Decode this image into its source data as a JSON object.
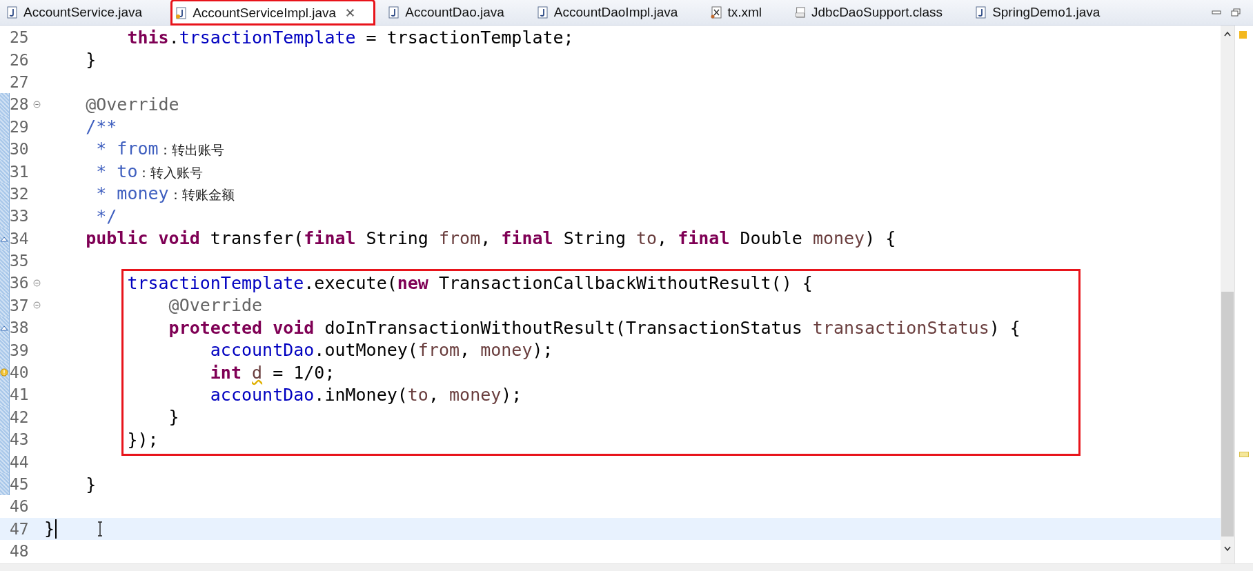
{
  "tabs": [
    {
      "label": "AccountService.java",
      "kind": "java",
      "selected": false,
      "boxed": false
    },
    {
      "label": "AccountServiceImpl.java",
      "kind": "java_warn",
      "selected": true,
      "boxed": true
    },
    {
      "label": "AccountDao.java",
      "kind": "java",
      "selected": false,
      "boxed": false
    },
    {
      "label": "AccountDaoImpl.java",
      "kind": "java",
      "selected": false,
      "boxed": false
    },
    {
      "label": "tx.xml",
      "kind": "xml",
      "selected": false,
      "boxed": false
    },
    {
      "label": "JdbcDaoSupport.class",
      "kind": "class",
      "selected": false,
      "boxed": false
    },
    {
      "label": "SpringDemo1.java",
      "kind": "java",
      "selected": false,
      "boxed": false
    }
  ],
  "lines": [
    {
      "num": "25",
      "tokens": [
        {
          "kind": "kw",
          "text": "        this"
        },
        {
          "kind": "plain",
          "text": "."
        },
        {
          "kind": "field",
          "text": "trsactionTemplate"
        },
        {
          "kind": "plain",
          "text": " = trsactionTemplate;"
        }
      ]
    },
    {
      "num": "26",
      "tokens": [
        {
          "kind": "plain",
          "text": "    }"
        }
      ]
    },
    {
      "num": "27"
    },
    {
      "num": "28",
      "fold": true,
      "scope": true,
      "tokens": [
        {
          "kind": "ann",
          "text": "    @Override"
        }
      ]
    },
    {
      "num": "29",
      "scope": true,
      "tokens": [
        {
          "kind": "doc",
          "text": "    /**"
        }
      ]
    },
    {
      "num": "30",
      "scope": true,
      "tokens": [
        {
          "kind": "doc",
          "text": "     * from"
        },
        {
          "kind": "cjk",
          "text": "：转出账号"
        }
      ]
    },
    {
      "num": "31",
      "scope": true,
      "tokens": [
        {
          "kind": "doc",
          "text": "     * to"
        },
        {
          "kind": "cjk",
          "text": "：转入账号"
        }
      ]
    },
    {
      "num": "32",
      "scope": true,
      "tokens": [
        {
          "kind": "doc",
          "text": "     * money"
        },
        {
          "kind": "cjk",
          "text": "：转账金额"
        }
      ]
    },
    {
      "num": "33",
      "scope": true,
      "tokens": [
        {
          "kind": "doc",
          "text": "     */"
        }
      ]
    },
    {
      "num": "34",
      "scope": true,
      "override": true,
      "tokens": [
        {
          "kind": "kw",
          "text": "    public void"
        },
        {
          "kind": "plain",
          "text": " transfer("
        },
        {
          "kind": "kw",
          "text": "final"
        },
        {
          "kind": "plain",
          "text": " String "
        },
        {
          "kind": "param",
          "text": "from"
        },
        {
          "kind": "plain",
          "text": ", "
        },
        {
          "kind": "kw",
          "text": "final"
        },
        {
          "kind": "plain",
          "text": " String "
        },
        {
          "kind": "param",
          "text": "to"
        },
        {
          "kind": "plain",
          "text": ", "
        },
        {
          "kind": "kw",
          "text": "final"
        },
        {
          "kind": "plain",
          "text": " Double "
        },
        {
          "kind": "param",
          "text": "money"
        },
        {
          "kind": "plain",
          "text": ") {"
        }
      ]
    },
    {
      "num": "35",
      "scope": true
    },
    {
      "num": "36",
      "fold": true,
      "scope": true,
      "boxed": true,
      "tokens": [
        {
          "kind": "field",
          "text": "        trsactionTemplate"
        },
        {
          "kind": "plain",
          "text": ".execute("
        },
        {
          "kind": "kw",
          "text": "new"
        },
        {
          "kind": "plain",
          "text": " TransactionCallbackWithoutResult() {"
        }
      ]
    },
    {
      "num": "37",
      "fold": true,
      "scope": true,
      "boxed": true,
      "tokens": [
        {
          "kind": "ann",
          "text": "            @Override"
        }
      ]
    },
    {
      "num": "38",
      "scope": true,
      "boxed": true,
      "override": true,
      "tokens": [
        {
          "kind": "kw",
          "text": "            protected void"
        },
        {
          "kind": "plain",
          "text": " doInTransactionWithoutResult(TransactionStatus "
        },
        {
          "kind": "param",
          "text": "transactionStatus"
        },
        {
          "kind": "plain",
          "text": ") {"
        }
      ]
    },
    {
      "num": "39",
      "scope": true,
      "boxed": true,
      "tokens": [
        {
          "kind": "field",
          "text": "                accountDao"
        },
        {
          "kind": "plain",
          "text": ".outMoney("
        },
        {
          "kind": "param",
          "text": "from"
        },
        {
          "kind": "plain",
          "text": ", "
        },
        {
          "kind": "param",
          "text": "money"
        },
        {
          "kind": "plain",
          "text": ");"
        }
      ]
    },
    {
      "num": "40",
      "scope": true,
      "boxed": true,
      "warning": true,
      "tokens": [
        {
          "kind": "kw",
          "text": "                int "
        },
        {
          "kind": "warnvar",
          "text": "d"
        },
        {
          "kind": "plain",
          "text": " = 1/0;"
        }
      ]
    },
    {
      "num": "41",
      "scope": true,
      "boxed": true,
      "tokens": [
        {
          "kind": "field",
          "text": "                accountDao"
        },
        {
          "kind": "plain",
          "text": ".inMoney("
        },
        {
          "kind": "param",
          "text": "to"
        },
        {
          "kind": "plain",
          "text": ", "
        },
        {
          "kind": "param",
          "text": "money"
        },
        {
          "kind": "plain",
          "text": ");"
        }
      ]
    },
    {
      "num": "42",
      "scope": true,
      "boxed": true,
      "tokens": [
        {
          "kind": "plain",
          "text": "            }"
        }
      ]
    },
    {
      "num": "43",
      "scope": true,
      "boxed": true,
      "tokens": [
        {
          "kind": "plain",
          "text": "        });"
        }
      ]
    },
    {
      "num": "44",
      "scope": true
    },
    {
      "num": "45",
      "scope": true,
      "tokens": [
        {
          "kind": "plain",
          "text": "    }"
        }
      ]
    },
    {
      "num": "46"
    },
    {
      "num": "47",
      "current": true,
      "tokens": [
        {
          "kind": "plain",
          "text": "}"
        }
      ]
    },
    {
      "num": "48"
    }
  ]
}
